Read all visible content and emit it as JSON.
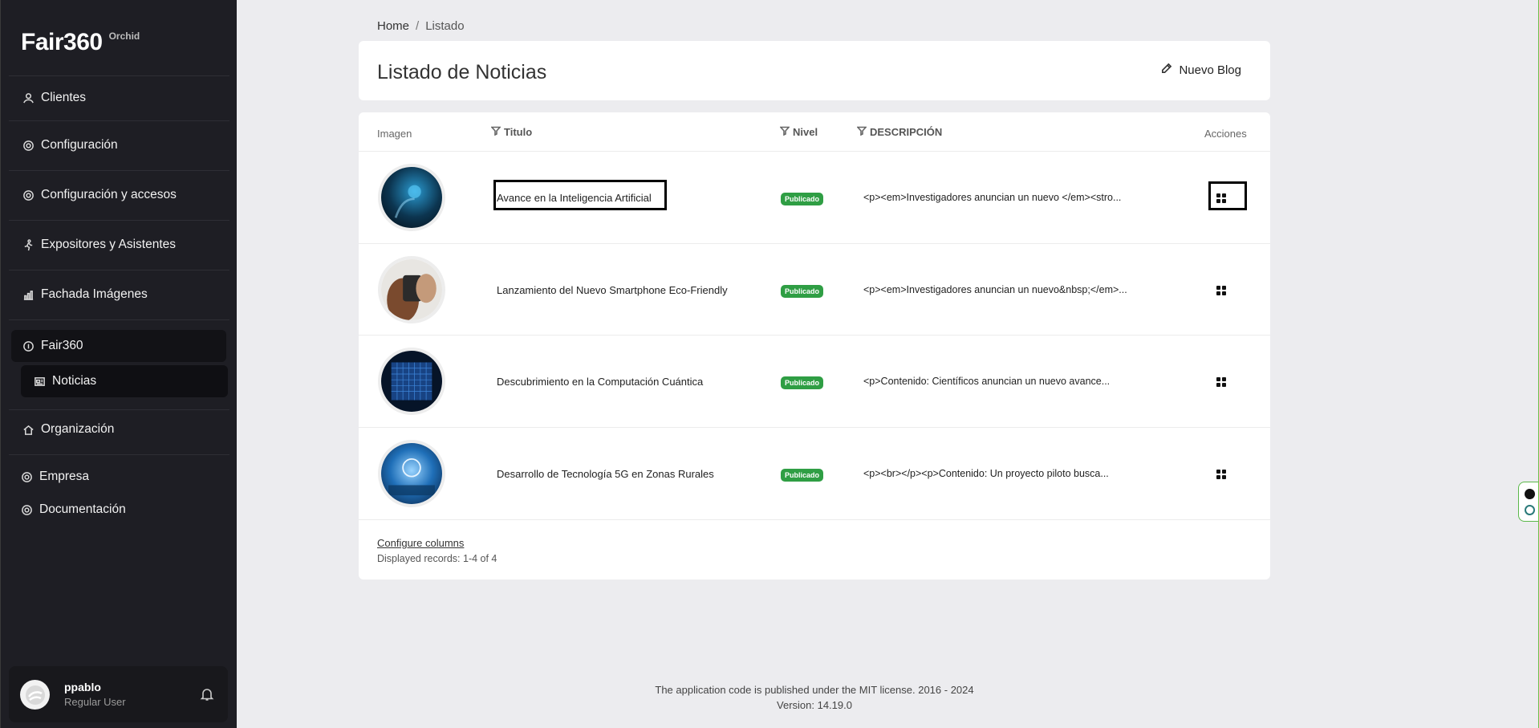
{
  "brand": {
    "name": "Fair360",
    "sub": "Orchid"
  },
  "sidebar": {
    "items": [
      {
        "label": "Clientes",
        "icon": "user-icon"
      },
      {
        "label": "Configuración",
        "icon": "gear-icon"
      },
      {
        "label": "Configuración y accesos",
        "icon": "gear-icon"
      },
      {
        "label": "Expositores y Asistentes",
        "icon": "walk-icon"
      },
      {
        "label": "Fachada Imágenes",
        "icon": "chart-icon"
      },
      {
        "label": "Fair360",
        "icon": "circle-icon"
      },
      {
        "label": "Noticias",
        "icon": "newspaper-icon"
      },
      {
        "label": "Organización",
        "icon": "home-icon"
      },
      {
        "label": "Empresa",
        "icon": "gear-icon"
      },
      {
        "label": "Documentación",
        "icon": "gear-icon"
      }
    ]
  },
  "user": {
    "name": "ppablo",
    "role": "Regular User"
  },
  "breadcrumb": {
    "home": "Home",
    "separator": "/",
    "current": "Listado"
  },
  "header": {
    "title": "Listado de Noticias",
    "new_blog": "Nuevo Blog"
  },
  "table": {
    "columns": {
      "image": "Imagen",
      "title": "Titulo",
      "level": "Nivel",
      "description": "DESCRIPCIÓN",
      "actions": "Acciones"
    },
    "rows": [
      {
        "title": "Avance en la Inteligencia Artificial",
        "status": "Publicado",
        "description": "<p><em>Investigadores anuncian un nuevo </em><stro..."
      },
      {
        "title": "Lanzamiento del Nuevo Smartphone Eco-Friendly",
        "status": "Publicado",
        "description": "<p><em>Investigadores anuncian un nuevo&nbsp;</em>..."
      },
      {
        "title": "Descubrimiento en la Computación Cuántica",
        "status": "Publicado",
        "description": "<p>Contenido: Científicos anuncian un nuevo avance..."
      },
      {
        "title": "Desarrollo de Tecnología 5G en Zonas Rurales",
        "status": "Publicado",
        "description": "<p><br></p><p>Contenido: Un proyecto piloto busca..."
      }
    ],
    "configure_columns": "Configure columns",
    "records": "Displayed records: 1-4 of 4"
  },
  "footer": {
    "license": "The application code is published under the MIT license. 2016 - 2024",
    "version": "Version: 14.19.0"
  },
  "colors": {
    "sidebar": "#1e1e24",
    "background": "#ececef",
    "badge": "#2f9e44"
  }
}
